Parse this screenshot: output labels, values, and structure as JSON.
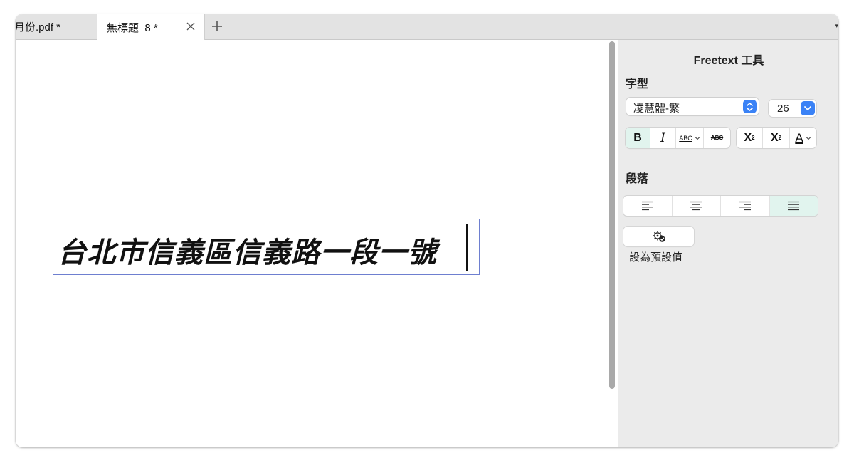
{
  "tabs": [
    {
      "label": "月份.pdf *",
      "active": false
    },
    {
      "label": "無標題_8 *",
      "active": true
    }
  ],
  "tabbar": {
    "overflow_mark": "▾"
  },
  "document": {
    "textbox_text": "台北市信義區信義路一段一號"
  },
  "inspector": {
    "title": "Freetext 工具",
    "font_section": "字型",
    "font_family": "凌慧體-繁",
    "font_size": "26",
    "format": {
      "bold": "B",
      "italic": "I",
      "underline": "ABC",
      "strikethrough": "ABC",
      "superscript": "X",
      "superscript_mark": "2",
      "subscript": "X",
      "subscript_mark": "2",
      "text_color": "A"
    },
    "paragraph_section": "段落",
    "alignment_selected": "justify",
    "set_default_label": "設為預設值"
  },
  "colors": {
    "accent": "#3a82f6",
    "selected_bg": "#e1f4ee",
    "textbox_border": "#6e7fd0"
  }
}
